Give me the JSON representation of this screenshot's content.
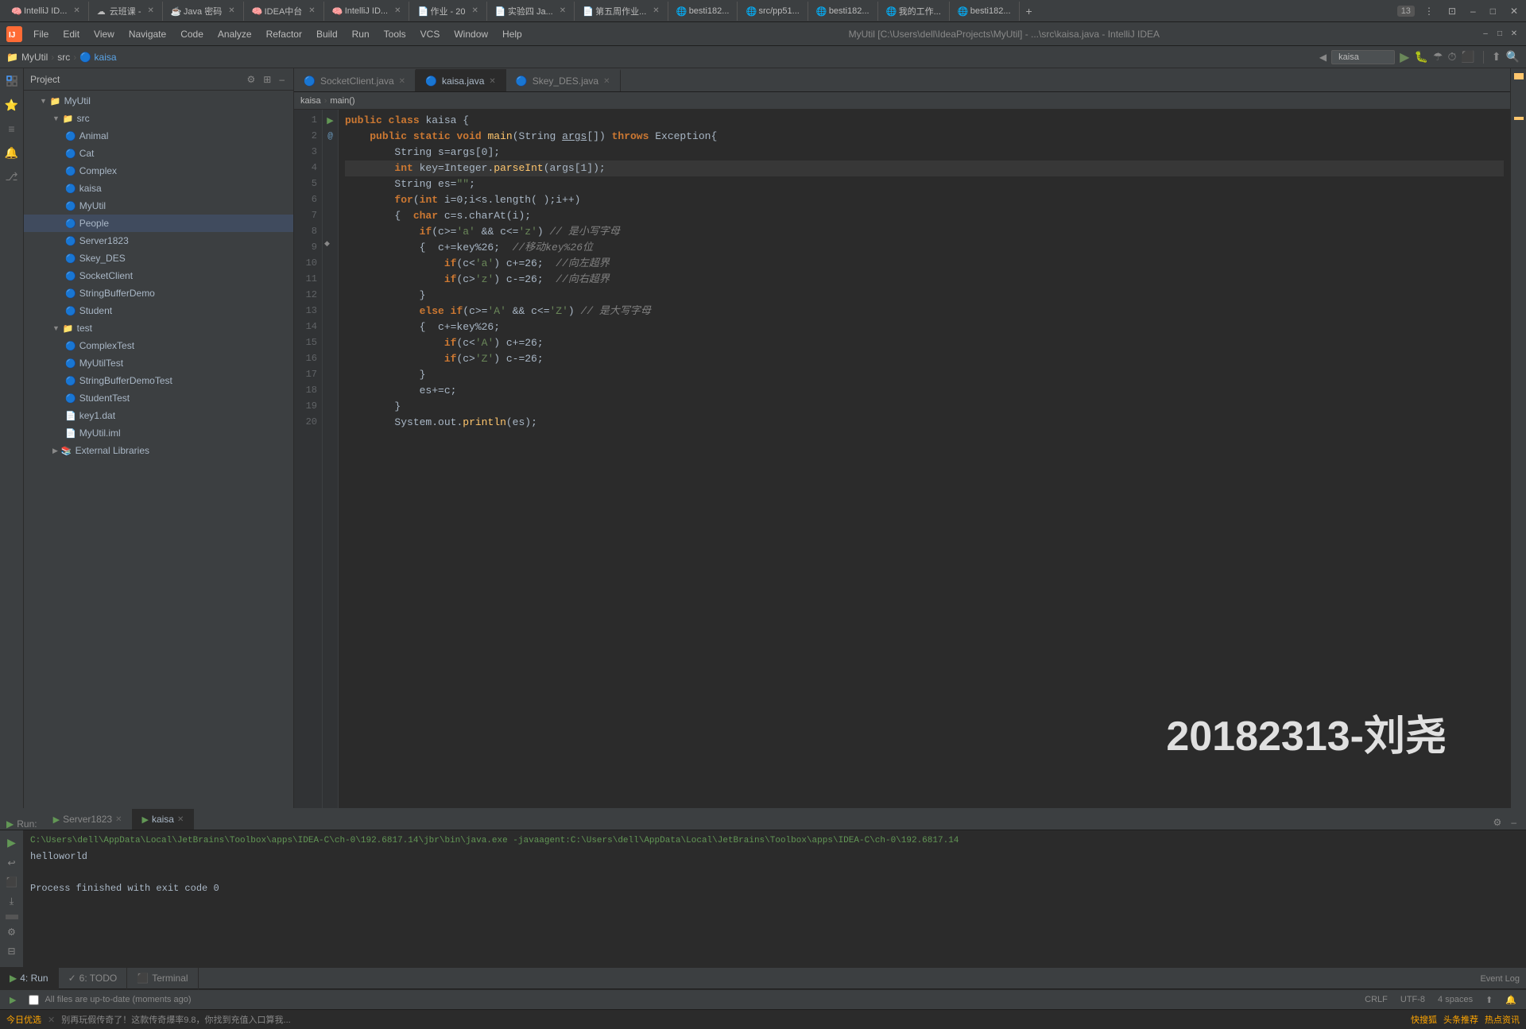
{
  "browser": {
    "tabs": [
      {
        "id": "tab1",
        "label": "IntelliJ ID...",
        "favicon": "🧠",
        "active": false,
        "closeable": true
      },
      {
        "id": "tab2",
        "label": "云班课 -",
        "favicon": "☁",
        "active": false,
        "closeable": true
      },
      {
        "id": "tab3",
        "label": "Java 密码",
        "favicon": "☕",
        "active": false,
        "closeable": true
      },
      {
        "id": "tab4",
        "label": "IDEA中台",
        "favicon": "🧠",
        "active": false,
        "closeable": true
      },
      {
        "id": "tab5",
        "label": "IntelliJ ID...",
        "favicon": "🧠",
        "active": false,
        "closeable": true
      },
      {
        "id": "tab6",
        "label": "作业 - 20",
        "favicon": "📄",
        "active": false,
        "closeable": true
      },
      {
        "id": "tab7",
        "label": "实验四 Ja...",
        "favicon": "📄",
        "active": false,
        "closeable": true
      },
      {
        "id": "tab8",
        "label": "第五周作业...",
        "favicon": "📄",
        "active": false,
        "closeable": true
      },
      {
        "id": "tab9",
        "label": "besti182...",
        "favicon": "🌐",
        "active": false,
        "closeable": false
      },
      {
        "id": "tab10",
        "label": "src/pp51...",
        "favicon": "🌐",
        "active": false,
        "closeable": false
      },
      {
        "id": "tab11",
        "label": "besti182...",
        "favicon": "🌐",
        "active": false,
        "closeable": false
      },
      {
        "id": "tab12",
        "label": "我的工作...",
        "favicon": "🌐",
        "active": false,
        "closeable": false
      },
      {
        "id": "tab13",
        "label": "besti182...",
        "favicon": "🌐",
        "active": false,
        "closeable": false
      }
    ],
    "tab_count": "13"
  },
  "ide": {
    "title": "MyUtil [C:\\Users\\dell\\IdeaProjects\\MyUtil] - ...\\src\\kaisa.java - IntelliJ IDEA",
    "menu_items": [
      "File",
      "Edit",
      "View",
      "Navigate",
      "Code",
      "Analyze",
      "Refactor",
      "Build",
      "Run",
      "Tools",
      "VCS",
      "Window",
      "Help"
    ]
  },
  "project_panel": {
    "title": "Project",
    "root": "MyUtil",
    "src_folder": "src",
    "files": [
      {
        "name": "Animal",
        "type": "java",
        "indent": 2
      },
      {
        "name": "Cat",
        "type": "java",
        "indent": 2
      },
      {
        "name": "Complex",
        "type": "java",
        "indent": 2
      },
      {
        "name": "kaisa",
        "type": "java",
        "indent": 2
      },
      {
        "name": "MyUtil",
        "type": "java",
        "indent": 2
      },
      {
        "name": "People",
        "type": "java",
        "indent": 2,
        "selected": true
      },
      {
        "name": "Server1823",
        "type": "java",
        "indent": 2
      },
      {
        "name": "Skey_DES",
        "type": "java",
        "indent": 2
      },
      {
        "name": "SocketClient",
        "type": "java",
        "indent": 2
      },
      {
        "name": "StringBufferDemo",
        "type": "java",
        "indent": 2
      },
      {
        "name": "Student",
        "type": "java",
        "indent": 2
      }
    ],
    "test_folder": "test",
    "test_files": [
      {
        "name": "ComplexTest",
        "type": "java",
        "indent": 3
      },
      {
        "name": "MyUtilTest",
        "type": "java",
        "indent": 3
      },
      {
        "name": "StringBufferDemoTest",
        "type": "java",
        "indent": 3
      },
      {
        "name": "StudentTest",
        "type": "java",
        "indent": 3
      }
    ],
    "data_files": [
      {
        "name": "key1.dat",
        "type": "dat",
        "indent": 2
      },
      {
        "name": "MyUtil.iml",
        "type": "iml",
        "indent": 2
      }
    ],
    "external": "External Libraries"
  },
  "editor": {
    "tabs": [
      {
        "id": "SocketClient",
        "label": "SocketClient.java",
        "active": false
      },
      {
        "id": "kaisa",
        "label": "kaisa.java",
        "active": true
      },
      {
        "id": "Skey_DES",
        "label": "Skey_DES.java",
        "active": false
      }
    ],
    "toolbar": {
      "run_config": "kaisa",
      "breadcrumb": [
        "kaisa",
        "main()"
      ]
    },
    "lines": [
      {
        "num": 1,
        "tokens": [
          {
            "t": "kw",
            "v": "public"
          },
          {
            "t": "op",
            "v": " "
          },
          {
            "t": "kw",
            "v": "class"
          },
          {
            "t": "op",
            "v": " "
          },
          {
            "t": "cls",
            "v": "kaisa"
          },
          {
            "t": "op",
            "v": " {"
          }
        ]
      },
      {
        "num": 2,
        "tokens": [
          {
            "t": "op",
            "v": "    "
          },
          {
            "t": "kw",
            "v": "public"
          },
          {
            "t": "op",
            "v": " "
          },
          {
            "t": "kw",
            "v": "static"
          },
          {
            "t": "op",
            "v": " "
          },
          {
            "t": "kw",
            "v": "void"
          },
          {
            "t": "op",
            "v": " "
          },
          {
            "t": "fn",
            "v": "main"
          },
          {
            "t": "op",
            "v": "("
          },
          {
            "t": "type",
            "v": "String"
          },
          {
            "t": "op",
            "v": " "
          },
          {
            "t": "param",
            "v": "args"
          },
          {
            "t": "op",
            "v": "[])"
          },
          {
            "t": "op",
            "v": " "
          },
          {
            "t": "kw",
            "v": "throws"
          },
          {
            "t": "op",
            "v": " "
          },
          {
            "t": "cls",
            "v": "Exception"
          },
          {
            "t": "op",
            "v": "{"
          }
        ]
      },
      {
        "num": 3,
        "tokens": [
          {
            "t": "op",
            "v": "        "
          },
          {
            "t": "type",
            "v": "String"
          },
          {
            "t": "op",
            "v": " s=args[0];"
          }
        ]
      },
      {
        "num": 4,
        "highlight": true,
        "tokens": [
          {
            "t": "op",
            "v": "        "
          },
          {
            "t": "kw",
            "v": "int"
          },
          {
            "t": "op",
            "v": " key="
          },
          {
            "t": "type",
            "v": "Integer"
          },
          {
            "t": "op",
            "v": "."
          },
          {
            "t": "fn",
            "v": "parseInt"
          },
          {
            "t": "op",
            "v": "(args[1]);"
          }
        ]
      },
      {
        "num": 5,
        "tokens": [
          {
            "t": "op",
            "v": "        "
          },
          {
            "t": "type",
            "v": "String"
          },
          {
            "t": "op",
            "v": " es="
          },
          {
            "t": "str",
            "v": "\"\""
          },
          {
            "t": "op",
            "v": ";"
          }
        ]
      },
      {
        "num": 6,
        "tokens": [
          {
            "t": "op",
            "v": "        "
          },
          {
            "t": "kw",
            "v": "for"
          },
          {
            "t": "op",
            "v": "("
          },
          {
            "t": "kw",
            "v": "int"
          },
          {
            "t": "op",
            "v": " i=0;i<s.length( );i++)"
          }
        ]
      },
      {
        "num": 7,
        "tokens": [
          {
            "t": "op",
            "v": "        {  "
          },
          {
            "t": "kw",
            "v": "char"
          },
          {
            "t": "op",
            "v": " c=s.charAt(i);"
          }
        ]
      },
      {
        "num": 8,
        "tokens": [
          {
            "t": "op",
            "v": "            "
          },
          {
            "t": "kw",
            "v": "if"
          },
          {
            "t": "op",
            "v": "(c>="
          },
          {
            "t": "str",
            "v": "'a'"
          },
          {
            "t": "op",
            "v": " && c<="
          },
          {
            "t": "str",
            "v": "'z'"
          },
          {
            "t": "op",
            "v": ") "
          },
          {
            "t": "cmt",
            "v": "// 是小写字母"
          }
        ]
      },
      {
        "num": 9,
        "tokens": [
          {
            "t": "op",
            "v": "            {  c+=key%26;  "
          },
          {
            "t": "cmt",
            "v": "//移动key%26位"
          }
        ]
      },
      {
        "num": 10,
        "tokens": [
          {
            "t": "op",
            "v": "                "
          },
          {
            "t": "kw",
            "v": "if"
          },
          {
            "t": "op",
            "v": "(c<"
          },
          {
            "t": "str",
            "v": "'a'"
          },
          {
            "t": "op",
            "v": ") c+=26;  "
          },
          {
            "t": "cmt",
            "v": "//向左超界"
          }
        ]
      },
      {
        "num": 11,
        "tokens": [
          {
            "t": "op",
            "v": "                "
          },
          {
            "t": "kw",
            "v": "if"
          },
          {
            "t": "op",
            "v": "(c>"
          },
          {
            "t": "str",
            "v": "'z'"
          },
          {
            "t": "op",
            "v": ") c-=26;  "
          },
          {
            "t": "cmt",
            "v": "//向右超界"
          }
        ]
      },
      {
        "num": 12,
        "tokens": [
          {
            "t": "op",
            "v": "            }"
          }
        ]
      },
      {
        "num": 13,
        "tokens": [
          {
            "t": "op",
            "v": "            "
          },
          {
            "t": "kw",
            "v": "else"
          },
          {
            "t": "op",
            "v": " "
          },
          {
            "t": "kw",
            "v": "if"
          },
          {
            "t": "op",
            "v": "(c>="
          },
          {
            "t": "str",
            "v": "'A'"
          },
          {
            "t": "op",
            "v": " && c<="
          },
          {
            "t": "str",
            "v": "'Z'"
          },
          {
            "t": "op",
            "v": ") "
          },
          {
            "t": "cmt",
            "v": "// 是大写字母"
          }
        ]
      },
      {
        "num": 14,
        "tokens": [
          {
            "t": "op",
            "v": "            {  c+=key%26;"
          }
        ]
      },
      {
        "num": 15,
        "tokens": [
          {
            "t": "op",
            "v": "                "
          },
          {
            "t": "kw",
            "v": "if"
          },
          {
            "t": "op",
            "v": "(c<"
          },
          {
            "t": "str",
            "v": "'A'"
          },
          {
            "t": "op",
            "v": ") c+=26;"
          }
        ]
      },
      {
        "num": 16,
        "tokens": [
          {
            "t": "op",
            "v": "                "
          },
          {
            "t": "kw",
            "v": "if"
          },
          {
            "t": "op",
            "v": "(c>"
          },
          {
            "t": "str",
            "v": "'Z'"
          },
          {
            "t": "op",
            "v": ") c-=26;"
          }
        ]
      },
      {
        "num": 17,
        "tokens": [
          {
            "t": "op",
            "v": "            }"
          }
        ]
      },
      {
        "num": 18,
        "tokens": [
          {
            "t": "op",
            "v": "            es+=c;"
          }
        ]
      },
      {
        "num": 19,
        "tokens": [
          {
            "t": "op",
            "v": "        }"
          }
        ]
      },
      {
        "num": 20,
        "tokens": [
          {
            "t": "op",
            "v": "        "
          },
          {
            "t": "type",
            "v": "System"
          },
          {
            "t": "op",
            "v": "."
          },
          {
            "t": "var",
            "v": "out"
          },
          {
            "t": "op",
            "v": "."
          },
          {
            "t": "fn",
            "v": "println"
          },
          {
            "t": "op",
            "v": "(es);"
          }
        ]
      }
    ]
  },
  "run_panel": {
    "title": "Run:",
    "tabs": [
      {
        "id": "Server1823",
        "label": "Server1823",
        "active": false
      },
      {
        "id": "kaisa",
        "label": "kaisa",
        "active": true
      }
    ],
    "command": "C:\\Users\\dell\\AppData\\Local\\JetBrains\\Toolbox\\apps\\IDEA-C\\ch-0\\192.6817.14\\jbr\\bin\\java.exe -javaagent:C:\\Users\\dell\\AppData\\Local\\JetBrains\\Toolbox\\apps\\IDEA-C\\ch-0\\192.6817.14",
    "output_lines": [
      "helloworld",
      "",
      "Process finished with exit code 0"
    ]
  },
  "bottom_tabs": [
    {
      "id": "run",
      "label": "4: Run",
      "active": true
    },
    {
      "id": "todo",
      "label": "6: TODO",
      "active": false
    },
    {
      "id": "terminal",
      "label": "Terminal",
      "active": false
    }
  ],
  "status_bar": {
    "message": "All files are up-to-date (moments ago)",
    "encoding": "CRLF",
    "charset": "UTF-8",
    "indent": "4 spaces",
    "event_log": "Event Log"
  },
  "watermark": "20182313-刘尧",
  "bottom_ad": {
    "left": "今日优选",
    "ad_text": "别再玩假传奇了！这款传奇爆率9.8，你找到充值入口算我...",
    "right_items": [
      "快搜狐",
      "头条推荐",
      "热点资讯"
    ]
  }
}
